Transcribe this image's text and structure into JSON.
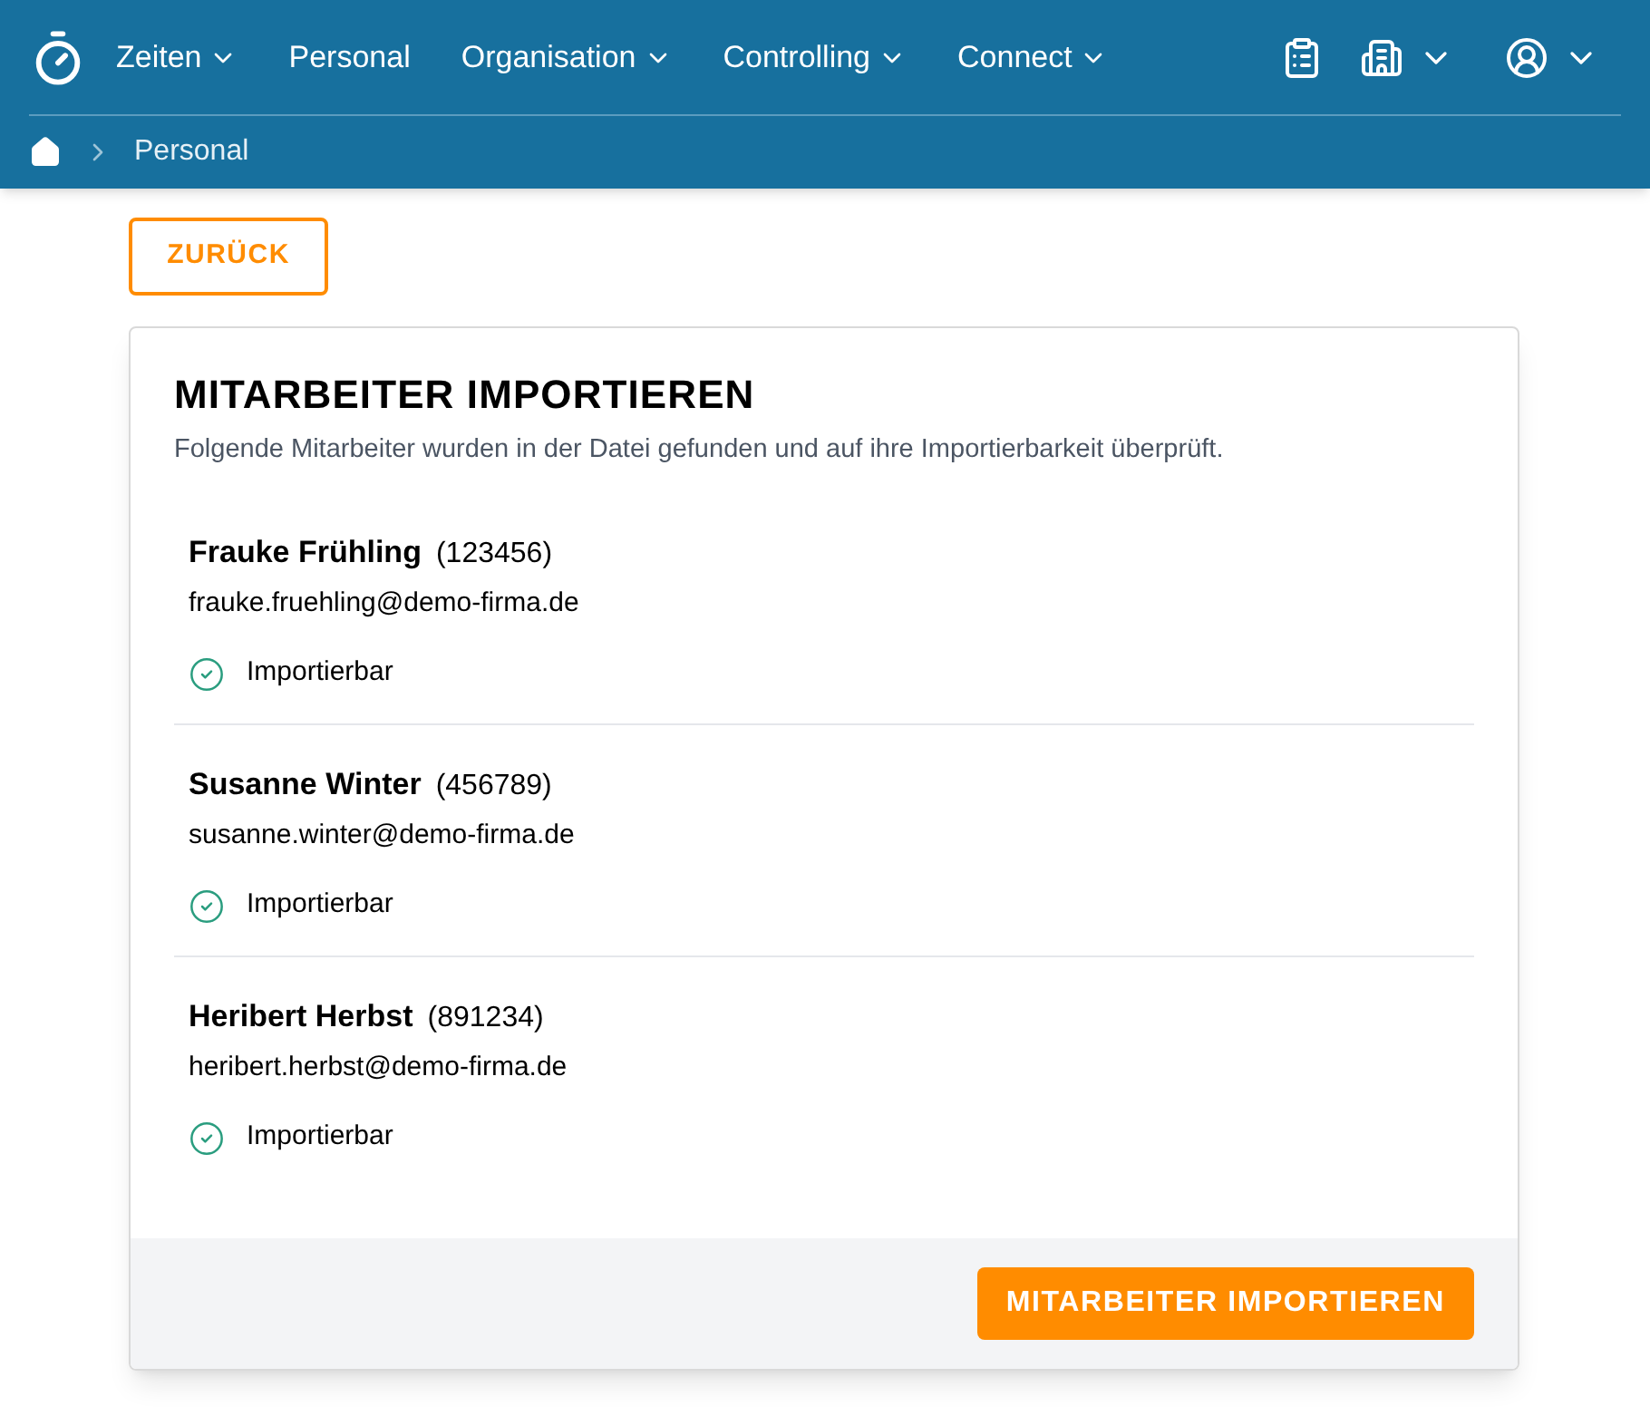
{
  "nav": {
    "items": [
      {
        "label": "Zeiten",
        "has_menu": true
      },
      {
        "label": "Personal",
        "has_menu": false
      },
      {
        "label": "Organisation",
        "has_menu": true
      },
      {
        "label": "Controlling",
        "has_menu": true
      },
      {
        "label": "Connect",
        "has_menu": true
      }
    ]
  },
  "breadcrumb": [
    "Personal"
  ],
  "back_button": "ZURÜCK",
  "card": {
    "title": "MITARBEITER IMPORTIEREN",
    "subtitle": "Folgende Mitarbeiter wurden in der Datei gefunden und auf ihre Importierbarkeit überprüft.",
    "employees": [
      {
        "name": "Frauke Frühling",
        "number": "(123456)",
        "email": "frauke.fruehling@demo-firma.de",
        "status": "Importierbar",
        "importable": true
      },
      {
        "name": "Susanne Winter",
        "number": "(456789)",
        "email": "susanne.winter@demo-firma.de",
        "status": "Importierbar",
        "importable": true
      },
      {
        "name": "Heribert Herbst",
        "number": "(891234)",
        "email": "heribert.herbst@demo-firma.de",
        "status": "Importierbar",
        "importable": true
      }
    ],
    "submit_button": "MITARBEITER IMPORTIEREN"
  }
}
